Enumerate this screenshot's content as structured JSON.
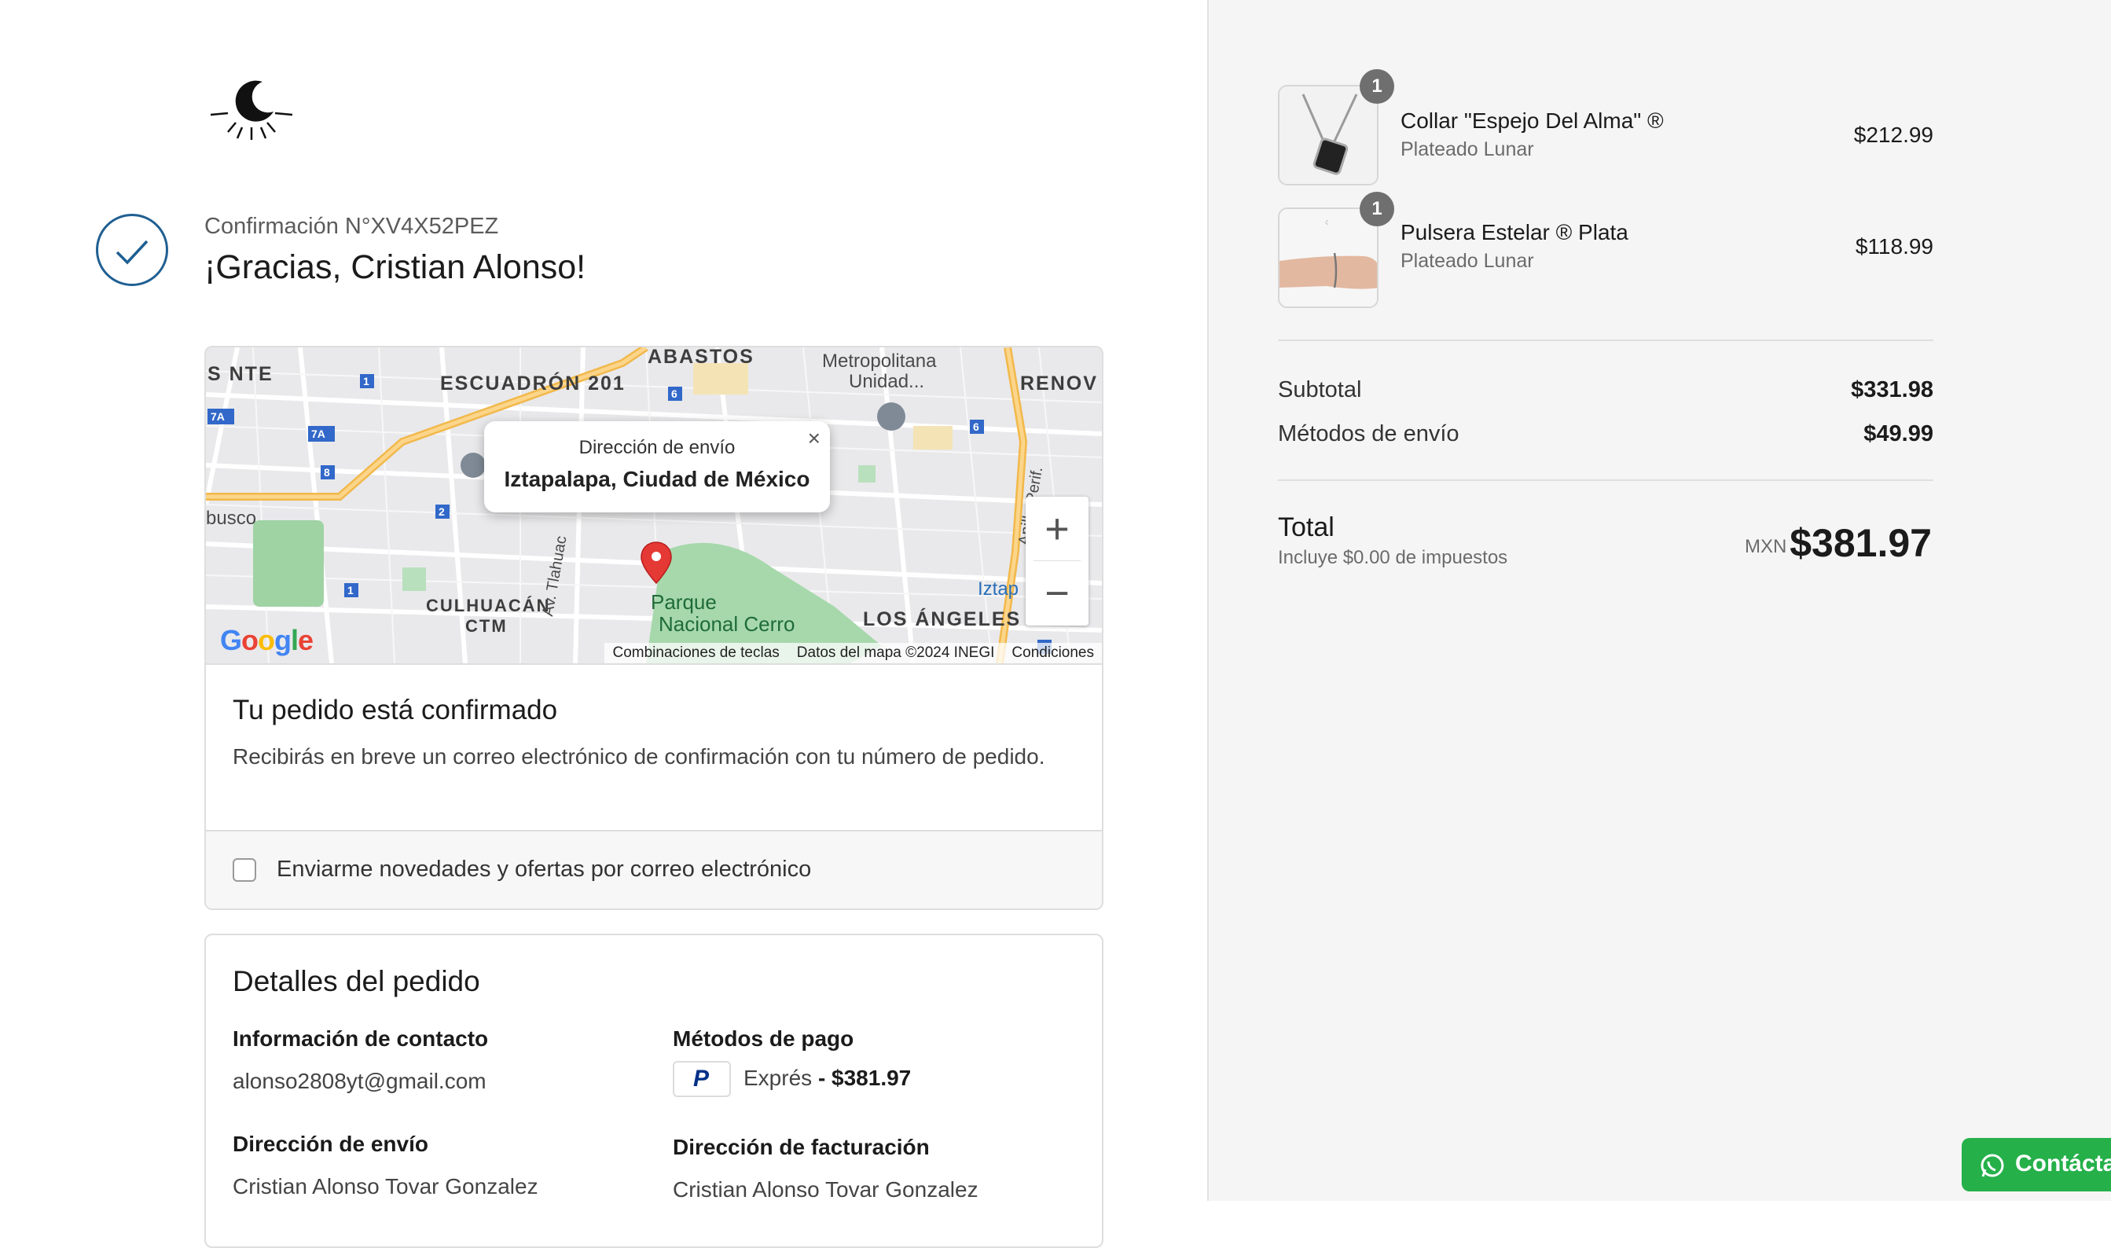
{
  "order": {
    "confirmation": "Confirmación N°XV4X52PEZ",
    "thanks": "¡Gracias, Cristian Alonso!"
  },
  "map": {
    "popup_title": "Dirección de envío",
    "popup_address": "Iztapalapa, Ciudad de México",
    "close_glyph": "×",
    "zoom_in": "+",
    "zoom_out": "−",
    "google": "Google",
    "labels": {
      "abastos": "ABASTOS",
      "escuadron": "ESCUADRÓN 201",
      "snte": "S NTE",
      "renov": "RENOV",
      "metropolitana": "Metropolitana",
      "unidad": "Unidad...",
      "busco": "busco",
      "culhuacan": "CULHUACÁN",
      "ctm": "CTM",
      "tlahuac": "Av. Tlahuac",
      "anillo": "Anillo Perif.",
      "iztap": "Iztap",
      "los_angeles": "LOS ÁNGELES",
      "parque1": "Parque",
      "parque2": "Nacional Cerro"
    },
    "footer": {
      "shortcuts": "Combinaciones de teclas",
      "data": "Datos del mapa ©2024 INEGI",
      "terms": "Condiciones"
    }
  },
  "confirmed": {
    "title": "Tu pedido está confirmado",
    "text": "Recibirás en breve un correo electrónico de confirmación con tu número de pedido.",
    "optin": "Enviarme novedades y ofertas por correo electrónico"
  },
  "details": {
    "title": "Detalles del pedido",
    "contact_h": "Información de contacto",
    "contact_v": "alonso2808yt@gmail.com",
    "payment_h": "Métodos de pago",
    "payment_method": "Exprés",
    "payment_amount": "- $381.97",
    "shipping_h": "Dirección de envío",
    "shipping_name": "Cristian Alonso Tovar Gonzalez",
    "billing_h": "Dirección de facturación",
    "billing_name": "Cristian Alonso Tovar Gonzalez"
  },
  "cart": {
    "items": [
      {
        "qty": "1",
        "name": "Collar \"Espejo Del Alma\" ®",
        "variant": "Plateado Lunar",
        "price": "$212.99"
      },
      {
        "qty": "1",
        "name": "Pulsera Estelar ® Plata",
        "variant": "Plateado Lunar",
        "price": "$118.99"
      }
    ],
    "subtotal_label": "Subtotal",
    "subtotal": "$331.98",
    "shipping_label": "Métodos de envío",
    "shipping": "$49.99",
    "total_label": "Total",
    "tax_note": "Incluye $0.00 de impuestos",
    "currency": "MXN",
    "total": "$381.97"
  },
  "whatsapp": {
    "label": "Contácta"
  },
  "colors": {
    "accent": "#1f5f92",
    "whatsapp": "#25b04a",
    "paypal": "#003087"
  }
}
